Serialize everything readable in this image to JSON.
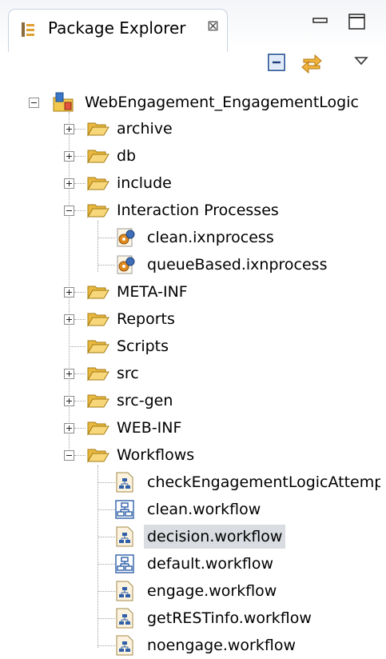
{
  "view": {
    "title": "Package Explorer",
    "close_glyph": "⊠",
    "icons": {
      "tab": "package-explorer-icon",
      "minimize": "minimize-icon",
      "maximize": "maximize-icon",
      "collapse_all": "collapse-all-icon",
      "link_editor": "link-with-editor-icon",
      "view_menu": "view-menu-icon"
    }
  },
  "tree": {
    "project": {
      "label": "WebEngagement_EngagementLogic",
      "icon": "project-icon"
    },
    "folders": [
      {
        "label": "archive",
        "icon": "folder-icon",
        "expander": "plus"
      },
      {
        "label": "db",
        "icon": "folder-icon",
        "expander": "plus"
      },
      {
        "label": "include",
        "icon": "folder-icon",
        "expander": "plus"
      },
      {
        "label": "Interaction Processes",
        "icon": "folder-icon",
        "expander": "minus",
        "children": [
          {
            "label": "clean.ixnprocess",
            "icon": "ixnprocess-icon"
          },
          {
            "label": "queueBased.ixnprocess",
            "icon": "ixnprocess-icon"
          }
        ]
      },
      {
        "label": "META-INF",
        "icon": "folder-icon",
        "expander": "plus"
      },
      {
        "label": "Reports",
        "icon": "folder-icon",
        "expander": "plus"
      },
      {
        "label": "Scripts",
        "icon": "folder-icon",
        "expander": "none"
      },
      {
        "label": "src",
        "icon": "folder-icon",
        "expander": "plus"
      },
      {
        "label": "src-gen",
        "icon": "folder-icon",
        "expander": "plus"
      },
      {
        "label": "WEB-INF",
        "icon": "folder-icon",
        "expander": "plus"
      },
      {
        "label": "Workflows",
        "icon": "folder-icon",
        "expander": "minus",
        "children": [
          {
            "label": "checkEngagementLogicAttemp",
            "icon": "workflow-file-icon"
          },
          {
            "label": "clean.workflow",
            "icon": "workflow-icon"
          },
          {
            "label": "decision.workflow",
            "icon": "workflow-file-icon",
            "selected": true
          },
          {
            "label": "default.workflow",
            "icon": "workflow-icon"
          },
          {
            "label": "engage.workflow",
            "icon": "workflow-file-icon"
          },
          {
            "label": "getRESTinfo.workflow",
            "icon": "workflow-file-icon"
          },
          {
            "label": "noengage.workflow",
            "icon": "workflow-file-icon"
          }
        ]
      }
    ]
  },
  "colors": {
    "folder": "#f2c94c",
    "workflow_blue": "#2f5fa8",
    "ixnprocess_orange": "#e08a1e",
    "selection": "#d9dce0"
  }
}
